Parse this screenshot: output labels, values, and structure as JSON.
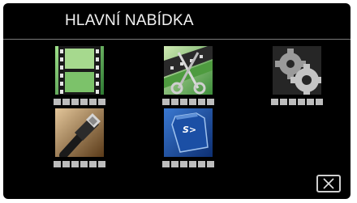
{
  "menu": {
    "title": "HLAVNÍ NABÍDKA",
    "items": [
      {
        "icon": "film-strip-icon",
        "label_placeholder": "■■■■■■"
      },
      {
        "icon": "edit-film-icon",
        "label_placeholder": "■■■■■■"
      },
      {
        "icon": "gear-settings-icon",
        "label_placeholder": "■■■■■■"
      },
      {
        "icon": "hdmi-cable-icon",
        "label_placeholder": "■■■■■■"
      },
      {
        "icon": "sd-card-icon",
        "label_placeholder": "■■■■■■",
        "card_text": "S>"
      }
    ]
  },
  "close_button": {
    "icon": "close-icon"
  },
  "colors": {
    "background": "#000000",
    "title_text": "#f2f2f2",
    "placeholder": "#bdbdbd",
    "sd_blue": "#1b4fa5"
  }
}
